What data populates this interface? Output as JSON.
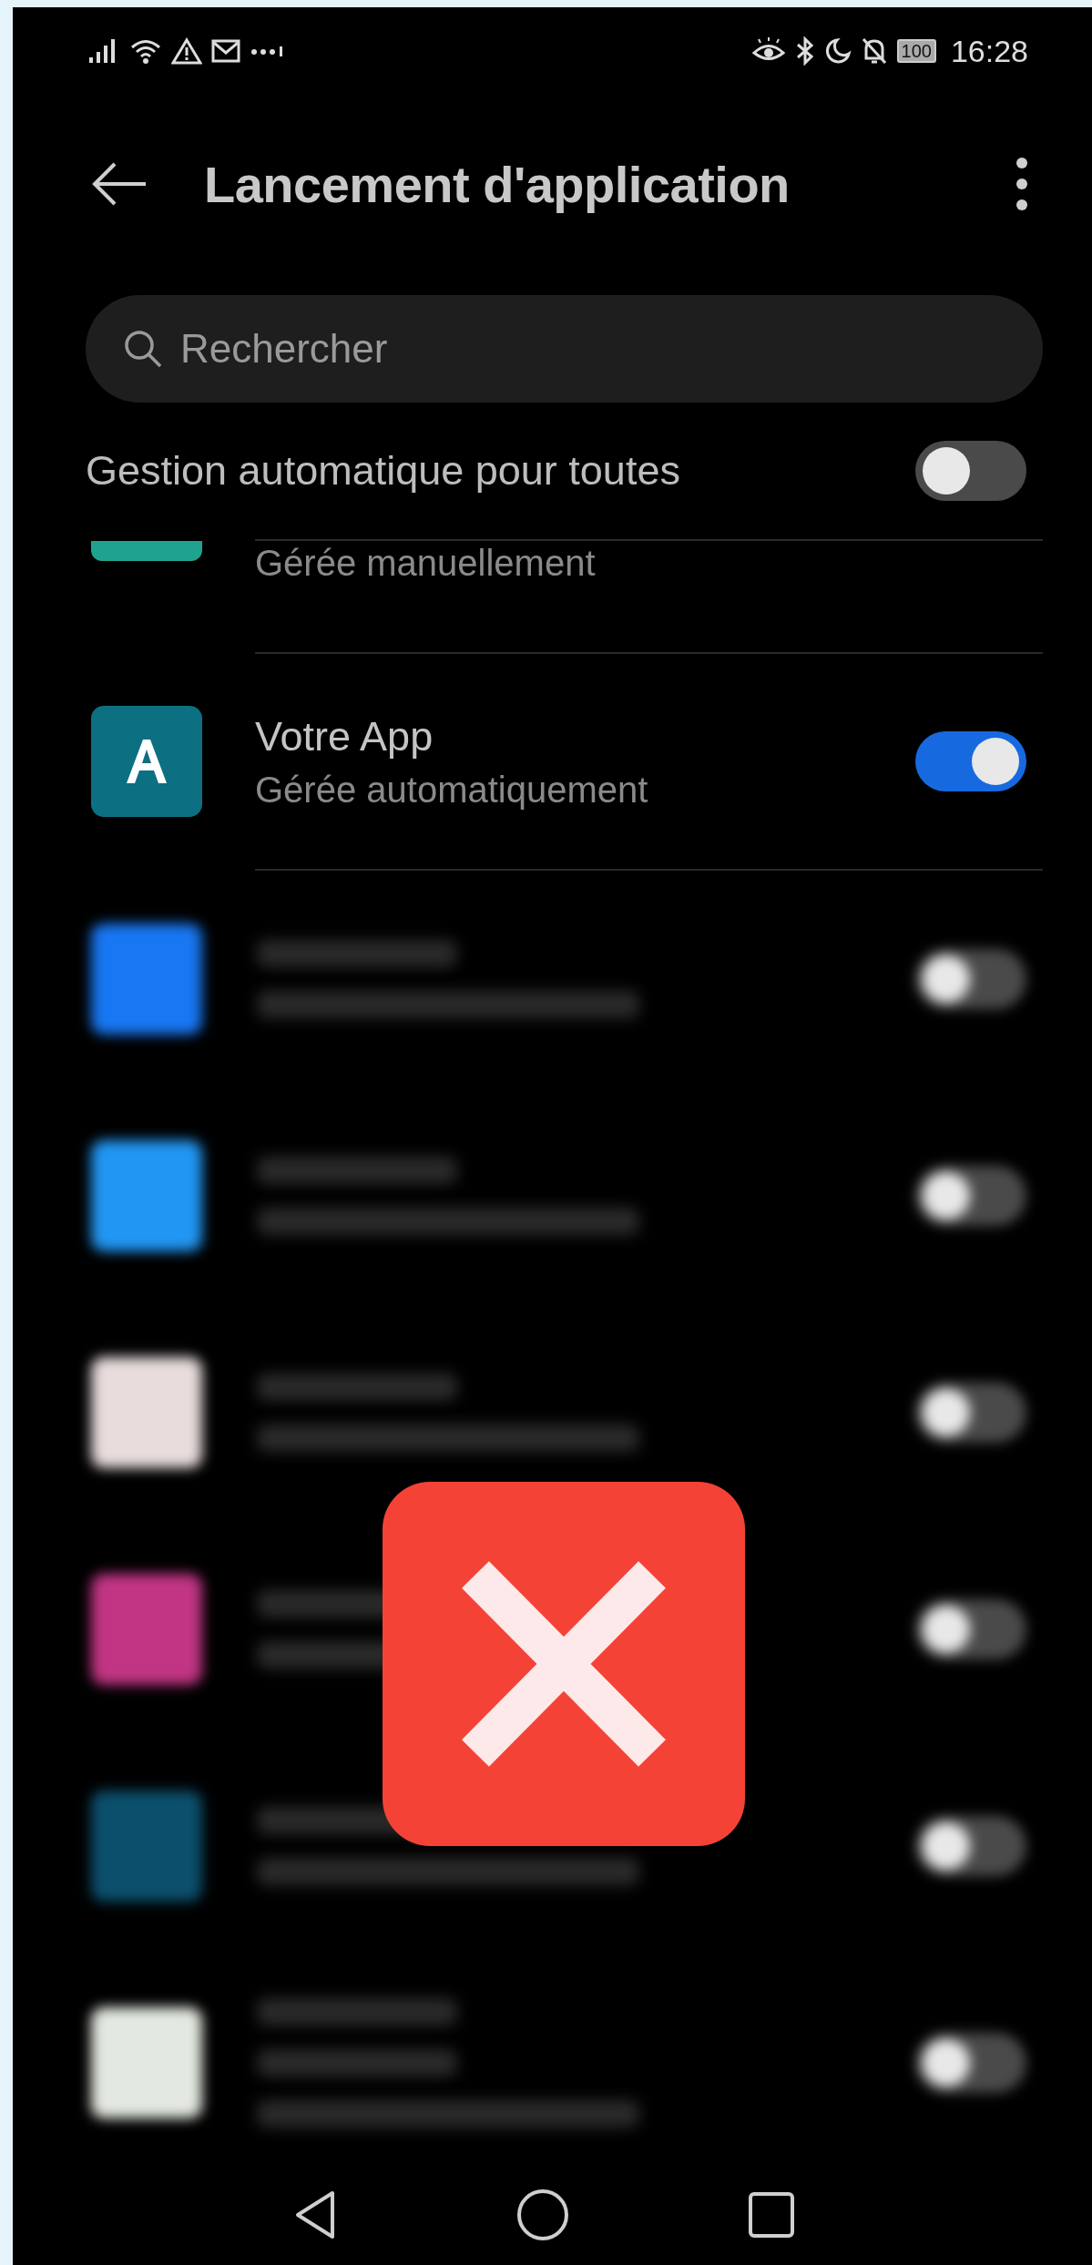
{
  "status_bar": {
    "battery": "100",
    "time": "16:28"
  },
  "header": {
    "title": "Lancement d'application"
  },
  "search": {
    "placeholder": "Rechercher"
  },
  "auto_all": {
    "label": "Gestion automatique pour toutes",
    "on": false
  },
  "apps": [
    {
      "kind": "partial",
      "subtitle": "Gérée manuellement",
      "color": "#1fa38e"
    },
    {
      "kind": "clear",
      "title": "Votre App",
      "subtitle": "Gérée automatiquement",
      "on": true,
      "color": "#0d6f82"
    },
    {
      "kind": "blurred",
      "color": "#1877f2",
      "on": false
    },
    {
      "kind": "blurred",
      "color": "#2196f3",
      "on": false
    },
    {
      "kind": "blurred",
      "color": "#e8dcdc",
      "on": false
    },
    {
      "kind": "blurred",
      "color": "#c13584",
      "on": false
    },
    {
      "kind": "blurred",
      "color": "#0b4f6c",
      "on": false
    },
    {
      "kind": "blurred-long",
      "color": "#e3e8e0",
      "on": false
    }
  ]
}
